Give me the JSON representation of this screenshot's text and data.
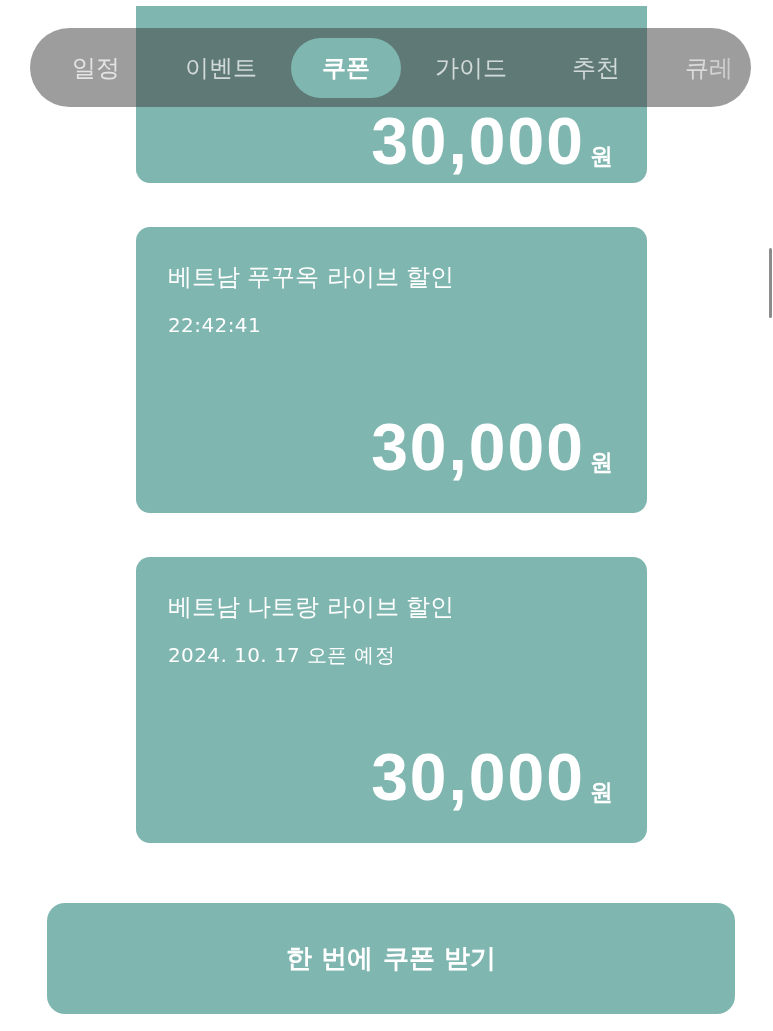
{
  "tab_bar": {
    "tabs": [
      {
        "label": "일정",
        "selected": false
      },
      {
        "label": "이벤트",
        "selected": false
      },
      {
        "label": "쿠폰",
        "selected": true
      },
      {
        "label": "가이드",
        "selected": false
      },
      {
        "label": "추천",
        "selected": false
      },
      {
        "label": "큐레",
        "selected": false
      }
    ]
  },
  "coupons": [
    {
      "amount": "30,000",
      "unit": "원"
    },
    {
      "title": "베트남 푸꾸옥 라이브 할인",
      "subtitle": "22:42:41",
      "amount": "30,000",
      "unit": "원"
    },
    {
      "title": "베트남 나트랑 라이브 할인",
      "subtitle": "2024. 10. 17 오픈 예정",
      "amount": "30,000",
      "unit": "원"
    }
  ],
  "claim_all_button": {
    "label": "한 번에 쿠폰 받기"
  }
}
